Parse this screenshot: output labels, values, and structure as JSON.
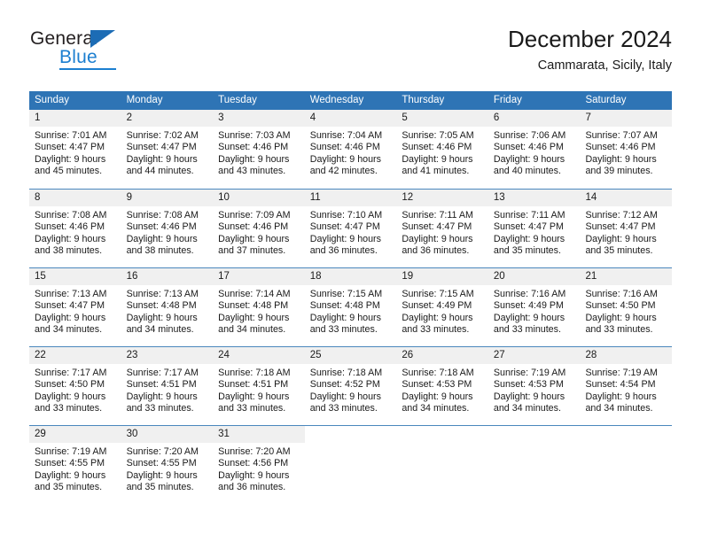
{
  "brand": {
    "name_part1": "General",
    "name_part2": "Blue"
  },
  "header": {
    "title": "December 2024",
    "subtitle": "Cammarata, Sicily, Italy"
  },
  "colors": {
    "header_blue": "#2e74b5",
    "brand_blue": "#1c7fd0",
    "day_band_gray": "#f0f0f0",
    "row_divider": "#4a87bd"
  },
  "calendar": {
    "weekdays": [
      "Sunday",
      "Monday",
      "Tuesday",
      "Wednesday",
      "Thursday",
      "Friday",
      "Saturday"
    ],
    "weeks": [
      [
        {
          "day": "1",
          "sunrise": "Sunrise: 7:01 AM",
          "sunset": "Sunset: 4:47 PM",
          "daylight_line1": "Daylight: 9 hours",
          "daylight_line2": "and 45 minutes."
        },
        {
          "day": "2",
          "sunrise": "Sunrise: 7:02 AM",
          "sunset": "Sunset: 4:47 PM",
          "daylight_line1": "Daylight: 9 hours",
          "daylight_line2": "and 44 minutes."
        },
        {
          "day": "3",
          "sunrise": "Sunrise: 7:03 AM",
          "sunset": "Sunset: 4:46 PM",
          "daylight_line1": "Daylight: 9 hours",
          "daylight_line2": "and 43 minutes."
        },
        {
          "day": "4",
          "sunrise": "Sunrise: 7:04 AM",
          "sunset": "Sunset: 4:46 PM",
          "daylight_line1": "Daylight: 9 hours",
          "daylight_line2": "and 42 minutes."
        },
        {
          "day": "5",
          "sunrise": "Sunrise: 7:05 AM",
          "sunset": "Sunset: 4:46 PM",
          "daylight_line1": "Daylight: 9 hours",
          "daylight_line2": "and 41 minutes."
        },
        {
          "day": "6",
          "sunrise": "Sunrise: 7:06 AM",
          "sunset": "Sunset: 4:46 PM",
          "daylight_line1": "Daylight: 9 hours",
          "daylight_line2": "and 40 minutes."
        },
        {
          "day": "7",
          "sunrise": "Sunrise: 7:07 AM",
          "sunset": "Sunset: 4:46 PM",
          "daylight_line1": "Daylight: 9 hours",
          "daylight_line2": "and 39 minutes."
        }
      ],
      [
        {
          "day": "8",
          "sunrise": "Sunrise: 7:08 AM",
          "sunset": "Sunset: 4:46 PM",
          "daylight_line1": "Daylight: 9 hours",
          "daylight_line2": "and 38 minutes."
        },
        {
          "day": "9",
          "sunrise": "Sunrise: 7:08 AM",
          "sunset": "Sunset: 4:46 PM",
          "daylight_line1": "Daylight: 9 hours",
          "daylight_line2": "and 38 minutes."
        },
        {
          "day": "10",
          "sunrise": "Sunrise: 7:09 AM",
          "sunset": "Sunset: 4:46 PM",
          "daylight_line1": "Daylight: 9 hours",
          "daylight_line2": "and 37 minutes."
        },
        {
          "day": "11",
          "sunrise": "Sunrise: 7:10 AM",
          "sunset": "Sunset: 4:47 PM",
          "daylight_line1": "Daylight: 9 hours",
          "daylight_line2": "and 36 minutes."
        },
        {
          "day": "12",
          "sunrise": "Sunrise: 7:11 AM",
          "sunset": "Sunset: 4:47 PM",
          "daylight_line1": "Daylight: 9 hours",
          "daylight_line2": "and 36 minutes."
        },
        {
          "day": "13",
          "sunrise": "Sunrise: 7:11 AM",
          "sunset": "Sunset: 4:47 PM",
          "daylight_line1": "Daylight: 9 hours",
          "daylight_line2": "and 35 minutes."
        },
        {
          "day": "14",
          "sunrise": "Sunrise: 7:12 AM",
          "sunset": "Sunset: 4:47 PM",
          "daylight_line1": "Daylight: 9 hours",
          "daylight_line2": "and 35 minutes."
        }
      ],
      [
        {
          "day": "15",
          "sunrise": "Sunrise: 7:13 AM",
          "sunset": "Sunset: 4:47 PM",
          "daylight_line1": "Daylight: 9 hours",
          "daylight_line2": "and 34 minutes."
        },
        {
          "day": "16",
          "sunrise": "Sunrise: 7:13 AM",
          "sunset": "Sunset: 4:48 PM",
          "daylight_line1": "Daylight: 9 hours",
          "daylight_line2": "and 34 minutes."
        },
        {
          "day": "17",
          "sunrise": "Sunrise: 7:14 AM",
          "sunset": "Sunset: 4:48 PM",
          "daylight_line1": "Daylight: 9 hours",
          "daylight_line2": "and 34 minutes."
        },
        {
          "day": "18",
          "sunrise": "Sunrise: 7:15 AM",
          "sunset": "Sunset: 4:48 PM",
          "daylight_line1": "Daylight: 9 hours",
          "daylight_line2": "and 33 minutes."
        },
        {
          "day": "19",
          "sunrise": "Sunrise: 7:15 AM",
          "sunset": "Sunset: 4:49 PM",
          "daylight_line1": "Daylight: 9 hours",
          "daylight_line2": "and 33 minutes."
        },
        {
          "day": "20",
          "sunrise": "Sunrise: 7:16 AM",
          "sunset": "Sunset: 4:49 PM",
          "daylight_line1": "Daylight: 9 hours",
          "daylight_line2": "and 33 minutes."
        },
        {
          "day": "21",
          "sunrise": "Sunrise: 7:16 AM",
          "sunset": "Sunset: 4:50 PM",
          "daylight_line1": "Daylight: 9 hours",
          "daylight_line2": "and 33 minutes."
        }
      ],
      [
        {
          "day": "22",
          "sunrise": "Sunrise: 7:17 AM",
          "sunset": "Sunset: 4:50 PM",
          "daylight_line1": "Daylight: 9 hours",
          "daylight_line2": "and 33 minutes."
        },
        {
          "day": "23",
          "sunrise": "Sunrise: 7:17 AM",
          "sunset": "Sunset: 4:51 PM",
          "daylight_line1": "Daylight: 9 hours",
          "daylight_line2": "and 33 minutes."
        },
        {
          "day": "24",
          "sunrise": "Sunrise: 7:18 AM",
          "sunset": "Sunset: 4:51 PM",
          "daylight_line1": "Daylight: 9 hours",
          "daylight_line2": "and 33 minutes."
        },
        {
          "day": "25",
          "sunrise": "Sunrise: 7:18 AM",
          "sunset": "Sunset: 4:52 PM",
          "daylight_line1": "Daylight: 9 hours",
          "daylight_line2": "and 33 minutes."
        },
        {
          "day": "26",
          "sunrise": "Sunrise: 7:18 AM",
          "sunset": "Sunset: 4:53 PM",
          "daylight_line1": "Daylight: 9 hours",
          "daylight_line2": "and 34 minutes."
        },
        {
          "day": "27",
          "sunrise": "Sunrise: 7:19 AM",
          "sunset": "Sunset: 4:53 PM",
          "daylight_line1": "Daylight: 9 hours",
          "daylight_line2": "and 34 minutes."
        },
        {
          "day": "28",
          "sunrise": "Sunrise: 7:19 AM",
          "sunset": "Sunset: 4:54 PM",
          "daylight_line1": "Daylight: 9 hours",
          "daylight_line2": "and 34 minutes."
        }
      ],
      [
        {
          "day": "29",
          "sunrise": "Sunrise: 7:19 AM",
          "sunset": "Sunset: 4:55 PM",
          "daylight_line1": "Daylight: 9 hours",
          "daylight_line2": "and 35 minutes."
        },
        {
          "day": "30",
          "sunrise": "Sunrise: 7:20 AM",
          "sunset": "Sunset: 4:55 PM",
          "daylight_line1": "Daylight: 9 hours",
          "daylight_line2": "and 35 minutes."
        },
        {
          "day": "31",
          "sunrise": "Sunrise: 7:20 AM",
          "sunset": "Sunset: 4:56 PM",
          "daylight_line1": "Daylight: 9 hours",
          "daylight_line2": "and 36 minutes."
        },
        {
          "day": "",
          "sunrise": "",
          "sunset": "",
          "daylight_line1": "",
          "daylight_line2": ""
        },
        {
          "day": "",
          "sunrise": "",
          "sunset": "",
          "daylight_line1": "",
          "daylight_line2": ""
        },
        {
          "day": "",
          "sunrise": "",
          "sunset": "",
          "daylight_line1": "",
          "daylight_line2": ""
        },
        {
          "day": "",
          "sunrise": "",
          "sunset": "",
          "daylight_line1": "",
          "daylight_line2": ""
        }
      ]
    ]
  }
}
